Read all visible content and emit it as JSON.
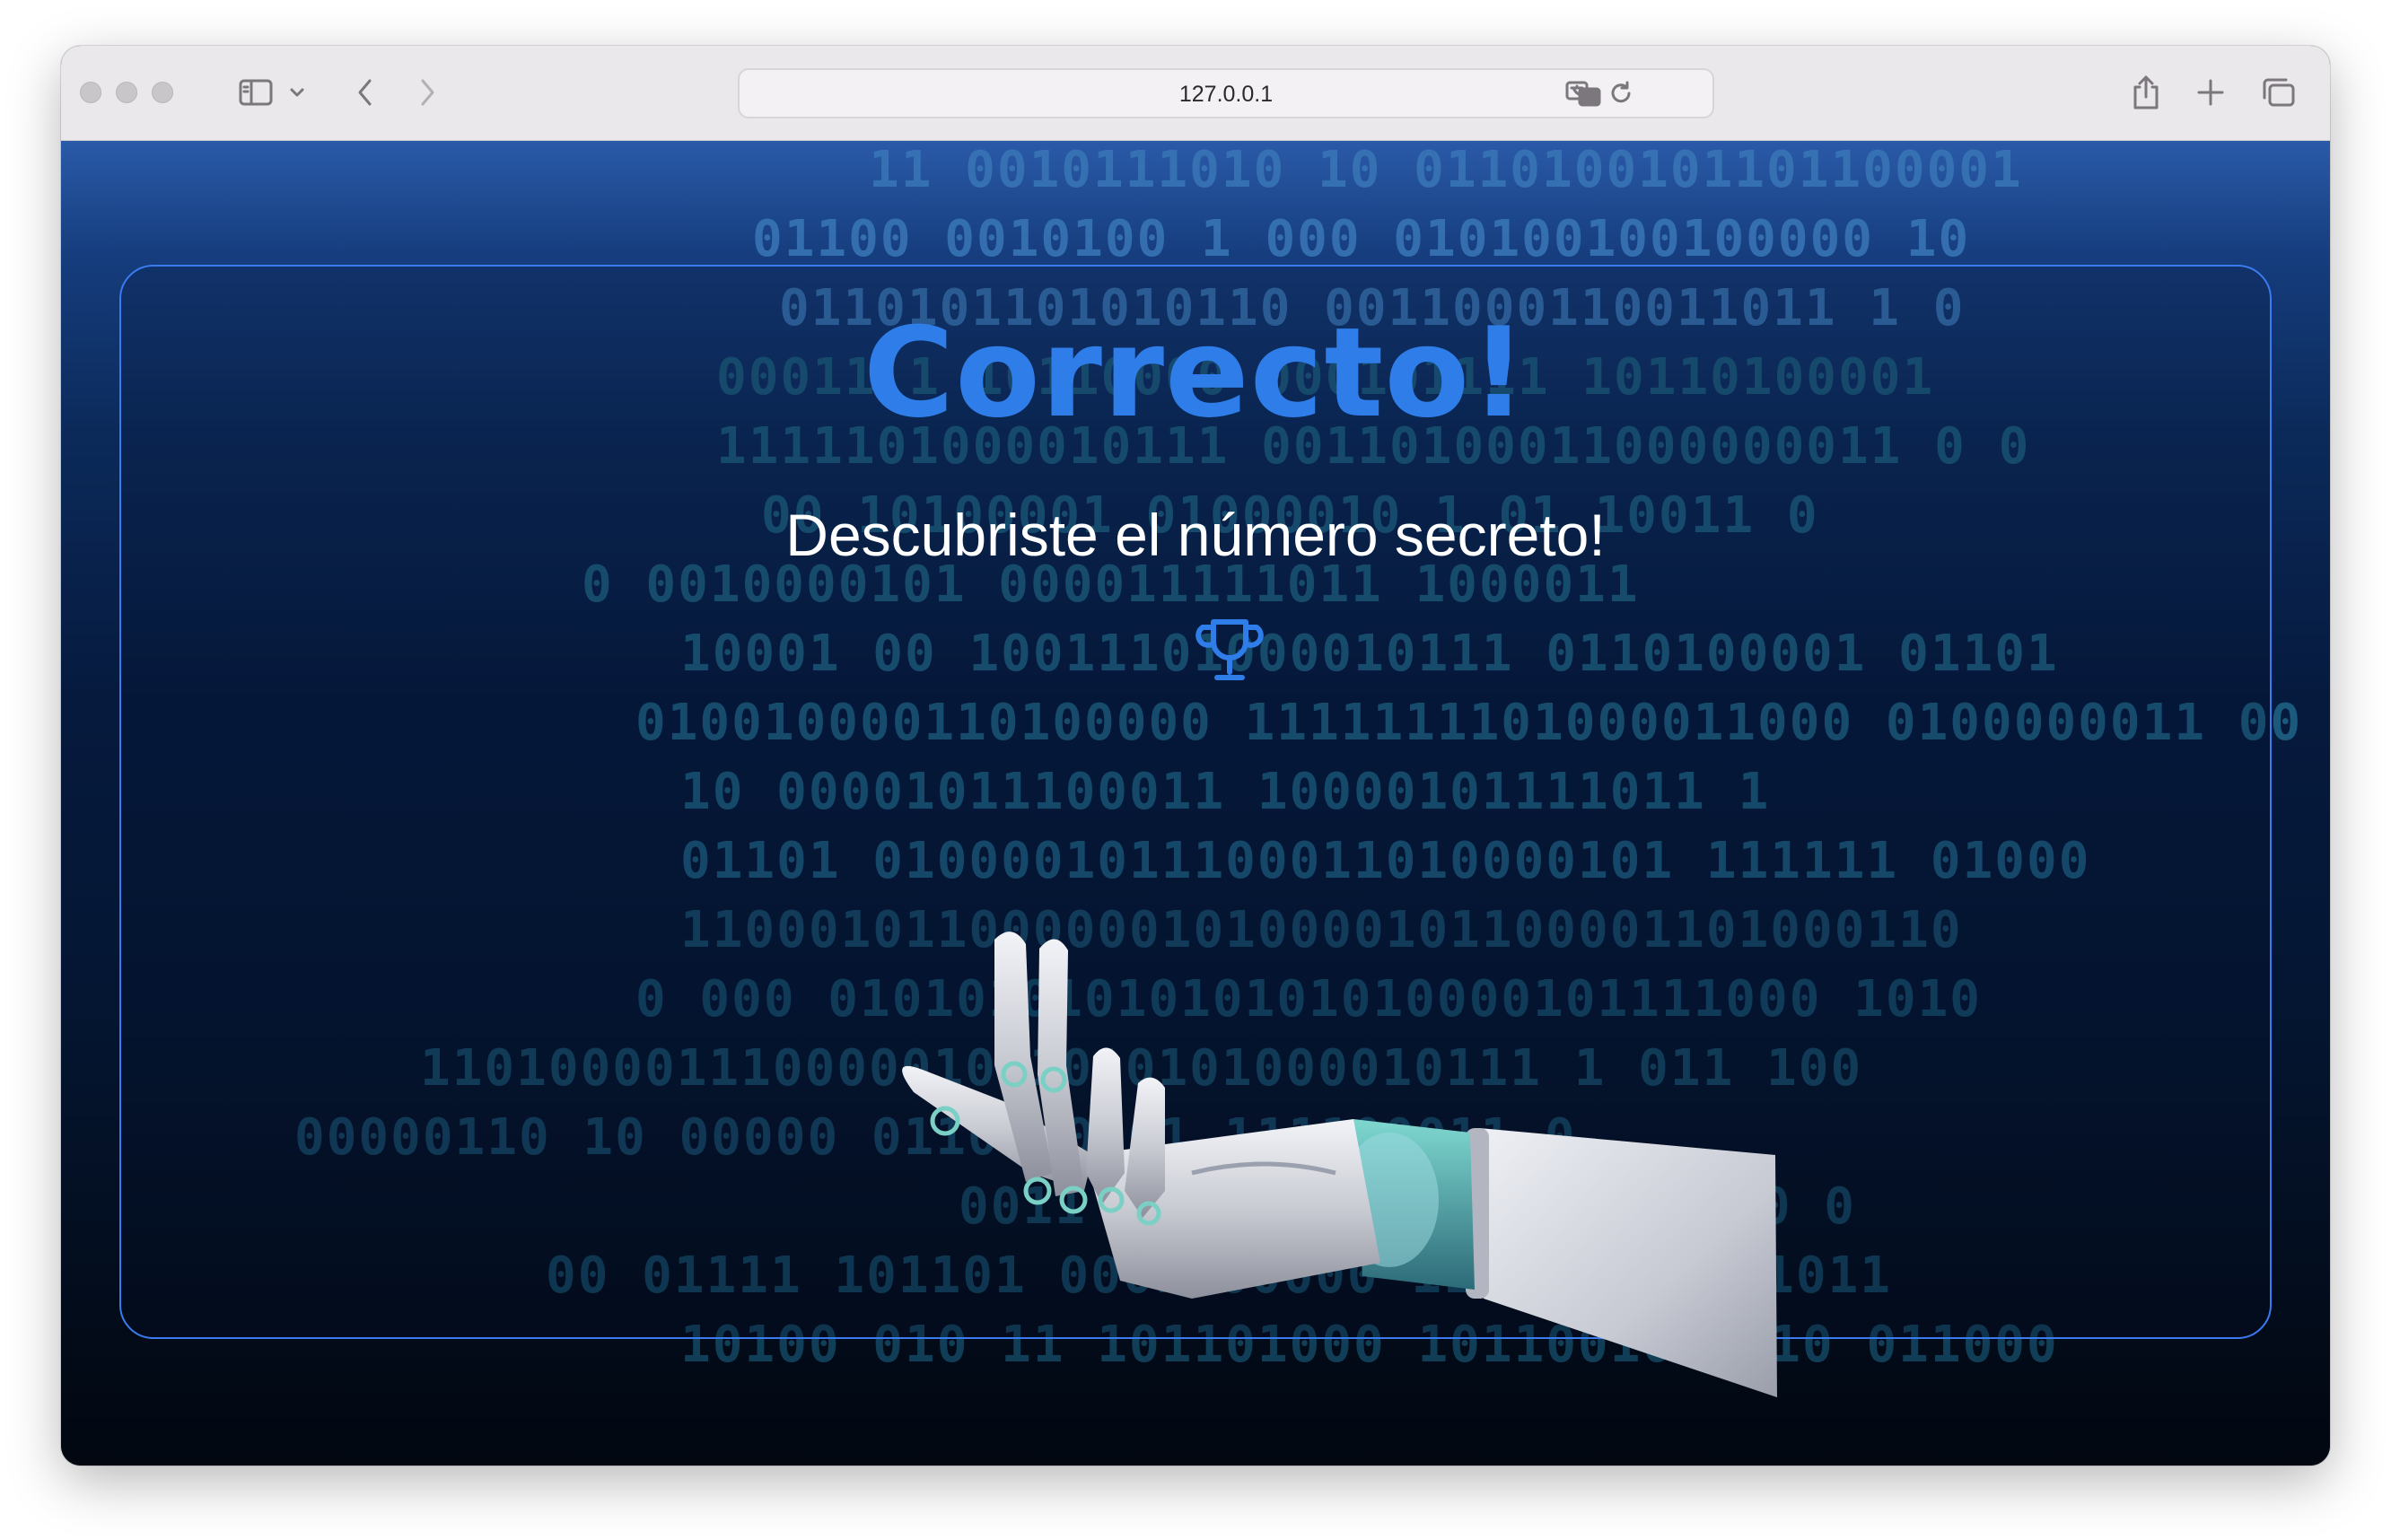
{
  "browser": {
    "url": "127.0.0.1"
  },
  "page": {
    "title": "Correcto!",
    "subtitle": "Descubriste el número secreto!",
    "trophy_icon": "trophy-icon",
    "accent_color": "#2f7de8",
    "panel_border_color": "#3a7bf0"
  },
  "binary_background": [
    "11 0010111010 10 0110100101101100001",
    "01100 0010100 1 000 010100100100000 10",
    "0110101101010110 0011000110011011 1 0",
    "00011 1 10110000 000101111 10110100001",
    "1111101000010111 00110100011000000011 0 0",
    "00 10100001 01000010 1 01 10011 0",
    "0 0010000101 000011111011 1000011",
    "10001 00 10011101000010111 0110100001 01101",
    "010010000110100000 1111111101000011000 0100000011 00",
    "10 00001011100011 10000101111011 1",
    "01101 0100001011100011010000101 111111 01000",
    "1100010110000001010000101100001101000110",
    "0 000 0101010101010101010000101111000 1010",
    "110100001110000010 1010101000010111 1 011 100",
    "00000110 10 00000 01101 0001 111100011 0",
    "0011 000101100101100000 00 0",
    "00 01111 101101 0001100000 110100101 11011",
    "10100 010 11 101101000 101100101 010 011000"
  ]
}
